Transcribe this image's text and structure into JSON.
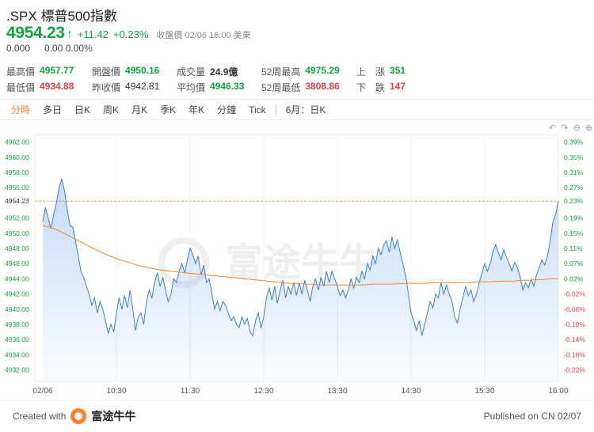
{
  "header": {
    "title": ".SPX 標普500指數",
    "price": "4954.23",
    "arrow": "↑",
    "change": "+11.42",
    "change_pct": "+0.23%",
    "close_info": "收盤價 02/06 16:00 美東",
    "ext_price": "0.000",
    "ext_change": "0.00 0.00%"
  },
  "stats": {
    "high_label": "最高價",
    "high": "4957.77",
    "open_label": "開盤價",
    "open": "4950.16",
    "volume_label": "成交量",
    "volume": "24.9億",
    "w52high_label": "52周最高",
    "w52high": "4975.29",
    "up_label": "上　漲",
    "up": "351",
    "low_label": "最低價",
    "low": "4934.88",
    "prevclose_label": "昨收價",
    "prevclose": "4942.81",
    "avg_label": "平均價",
    "avg": "4946.33",
    "w52low_label": "52周最低",
    "w52low": "3808.86",
    "down_label": "下　跌",
    "down": "147"
  },
  "tabs": [
    "分時",
    "多日",
    "日K",
    "周K",
    "月K",
    "季K",
    "年K",
    "分鐘",
    "Tick"
  ],
  "tab_extra": "6月：日K",
  "tools": [
    "undo-icon",
    "redo-icon",
    "zoom-out-icon",
    "zoom-in-icon"
  ],
  "footer": {
    "created_with": "Created with",
    "brand": "富途牛牛",
    "published": "Published on CN 02/07"
  },
  "watermark": "富途牛牛",
  "colors": {
    "up": "#14a340",
    "down": "#e23f3f",
    "accent": "#ff7f2a",
    "line": "#3a7fd5",
    "avg_line": "#f08a30"
  },
  "chart_data": {
    "type": "line",
    "y_ticks_left": [
      "4962.00",
      "4960.00",
      "4958.00",
      "4956.00",
      "4954.23",
      "4952.00",
      "4950.00",
      "4948.00",
      "4946.00",
      "4944.00",
      "4942.00",
      "4940.00",
      "4938.00",
      "4936.00",
      "4934.00",
      "4932.00"
    ],
    "y_ticks_right": [
      "0.39%",
      "0.35%",
      "0.31%",
      "0.27%",
      "0.23%",
      "0.19%",
      "0.15%",
      "0.11%",
      "0.07%",
      "0.02%",
      "-0.02%",
      "-0.06%",
      "-0.10%",
      "-0.14%",
      "-0.18%",
      "-0.22%"
    ],
    "x_labels": [
      "02/06",
      "10:30",
      "11:30",
      "12:30",
      "13:30",
      "14:30",
      "15:30",
      "16:00"
    ],
    "ylim": [
      4930.5,
      4963
    ],
    "prev_close": 4942.81,
    "last": 4954.23,
    "series": [
      {
        "values": [
          4951.5,
          4953.4,
          4952.0,
          4950.6,
          4952.5,
          4954.0,
          4956.0,
          4957.2,
          4955.5,
          4953.0,
          4951.0,
          4950.8,
          4949.0,
          4947.0,
          4945.0,
          4944.2,
          4943.0,
          4942.0,
          4940.5,
          4941.5,
          4939.5,
          4941.0,
          4940.0,
          4938.5,
          4936.8,
          4938.0,
          4937.0,
          4939.5,
          4941.5,
          4940.0,
          4941.8,
          4940.2,
          4942.5,
          4940.0,
          4937.2,
          4939.0,
          4939.5,
          4938.0,
          4941.0,
          4942.5,
          4941.5,
          4943.5,
          4944.8,
          4943.0,
          4944.2,
          4942.5,
          4941.0,
          4942.0,
          4944.0,
          4943.5,
          4945.0,
          4946.0,
          4944.8,
          4946.5,
          4948.0,
          4947.2,
          4946.0,
          4947.0,
          4944.5,
          4945.8,
          4943.5,
          4944.0,
          4942.0,
          4940.0,
          4941.0,
          4939.8,
          4941.0,
          4940.5,
          4939.5,
          4938.5,
          4939.0,
          4938.0,
          4937.6,
          4939.0,
          4938.0,
          4938.8,
          4937.0,
          4936.5,
          4938.5,
          4939.5,
          4937.5,
          4939.0,
          4941.5,
          4942.8,
          4941.2,
          4943.0,
          4940.8,
          4942.5,
          4943.8,
          4941.5,
          4943.0,
          4942.0,
          4943.5,
          4941.8,
          4943.5,
          4942.0,
          4943.8,
          4942.5,
          4941.0,
          4943.0,
          4944.0,
          4942.5,
          4944.2,
          4943.0,
          4945.0,
          4943.5,
          4945.0,
          4944.0,
          4943.0,
          4941.8,
          4942.5,
          4941.5,
          4942.5,
          4944.0,
          4942.8,
          4944.2,
          4943.5,
          4945.0,
          4944.0,
          4946.0,
          4945.2,
          4947.0,
          4946.0,
          4948.0,
          4947.2,
          4948.5,
          4949.0,
          4947.5,
          4949.5,
          4948.0,
          4949.2,
          4947.5,
          4946.0,
          4944.5,
          4942.0,
          4939.5,
          4938.5,
          4937.2,
          4938.5,
          4936.5,
          4938.0,
          4939.5,
          4941.0,
          4940.2,
          4942.0,
          4941.5,
          4943.5,
          4942.0,
          4943.2,
          4942.0,
          4941.0,
          4939.0,
          4938.2,
          4940.0,
          4941.5,
          4943.0,
          4941.8,
          4942.5,
          4941.0,
          4942.0,
          4943.5,
          4944.8,
          4946.0,
          4945.0,
          4946.0,
          4947.5,
          4948.5,
          4947.5,
          4946.5,
          4947.8,
          4946.8,
          4946.0,
          4945.0,
          4946.2,
          4945.5,
          4944.2,
          4942.5,
          4943.5,
          4942.8,
          4944.0,
          4943.0,
          4944.5,
          4945.5,
          4946.5,
          4945.8,
          4947.0,
          4949.0,
          4951.5,
          4952.5,
          4954.23
        ]
      },
      {
        "values": [
          4951.0,
          4950.8,
          4950.4,
          4949.9,
          4949.4,
          4948.9,
          4948.4,
          4947.9,
          4947.4,
          4947.0,
          4946.6,
          4946.3,
          4946.0,
          4945.7,
          4945.5,
          4945.3,
          4945.1,
          4945.0,
          4944.9,
          4944.8,
          4944.7,
          4944.6,
          4944.5,
          4944.4,
          4944.3,
          4944.2,
          4944.1,
          4944.0,
          4943.9,
          4943.8,
          4943.7,
          4943.6,
          4943.5,
          4943.4,
          4943.4,
          4943.3,
          4943.3,
          4943.2,
          4943.2,
          4943.2,
          4943.2,
          4943.2,
          4943.2,
          4943.2,
          4943.3,
          4943.3,
          4943.3,
          4943.3,
          4943.4,
          4943.4,
          4943.4,
          4943.4,
          4943.5,
          4943.5,
          4943.5,
          4943.5,
          4943.5,
          4943.5,
          4943.6,
          4943.6,
          4943.6,
          4943.7,
          4943.7,
          4943.7,
          4943.8,
          4943.8,
          4943.9,
          4943.9,
          4944.0,
          4944.0
        ]
      }
    ]
  }
}
